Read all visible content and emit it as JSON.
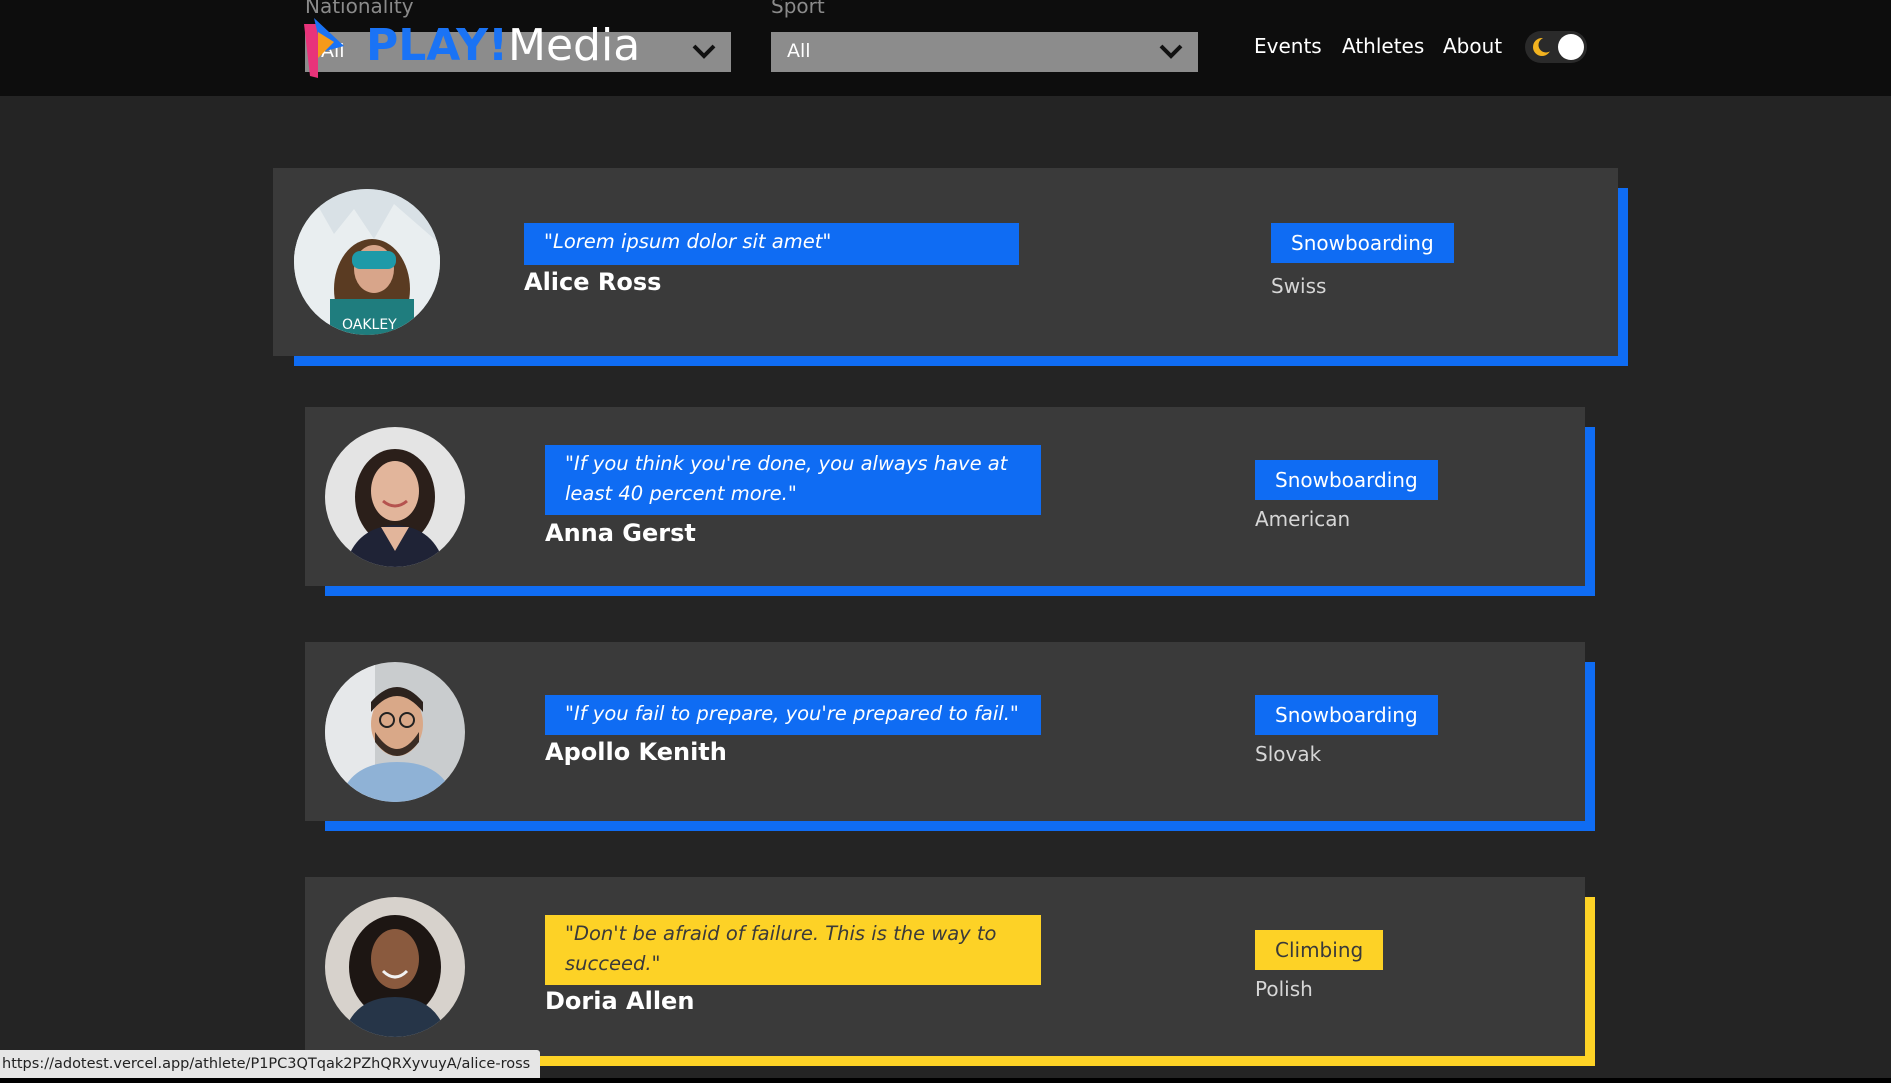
{
  "filters": {
    "nationality": {
      "label": "Nationality",
      "value": "All"
    },
    "sport": {
      "label": "Sport",
      "value": "All"
    }
  },
  "brand": {
    "play": "PLAY!",
    "media": "Media"
  },
  "nav": {
    "events": "Events",
    "athletes": "Athletes",
    "about": "About"
  },
  "theme_toggle": {
    "state": "dark"
  },
  "athletes": [
    {
      "quote": "\"Lorem ipsum dolor sit amet\"",
      "name": "Alice Ross",
      "sport": "Snowboarding",
      "nationality": "Swiss",
      "accent": "blue",
      "avatar_icon": "athlete-photo-alice-ross"
    },
    {
      "quote": "\"If you think you're done, you always have at\nleast 40 percent more.\"",
      "name": "Anna Gerst",
      "sport": "Snowboarding",
      "nationality": "American",
      "accent": "blue",
      "avatar_icon": "athlete-photo-anna-gerst"
    },
    {
      "quote": "\"If you fail to prepare, you're prepared to fail.\"",
      "name": "Apollo Kenith",
      "sport": "Snowboarding",
      "nationality": "Slovak",
      "accent": "blue",
      "avatar_icon": "athlete-photo-apollo-kenith"
    },
    {
      "quote": "\"Don't be afraid of failure. This is the way to\nsucceed.\"",
      "name": "Doria Allen",
      "sport": "Climbing",
      "nationality": "Polish",
      "accent": "yellow",
      "avatar_icon": "athlete-photo-doria-allen"
    }
  ],
  "colors": {
    "blue_accent": "#0f6cf3",
    "yellow_accent": "#fdd226",
    "card_bg": "#3a3a3a",
    "page_bg": "#242424",
    "header_bg": "#0d0d0d"
  },
  "status_bar": {
    "url": "https://adotest.vercel.app/athlete/P1PC3QTqak2PZhQRXyvuyA/alice-ross"
  }
}
